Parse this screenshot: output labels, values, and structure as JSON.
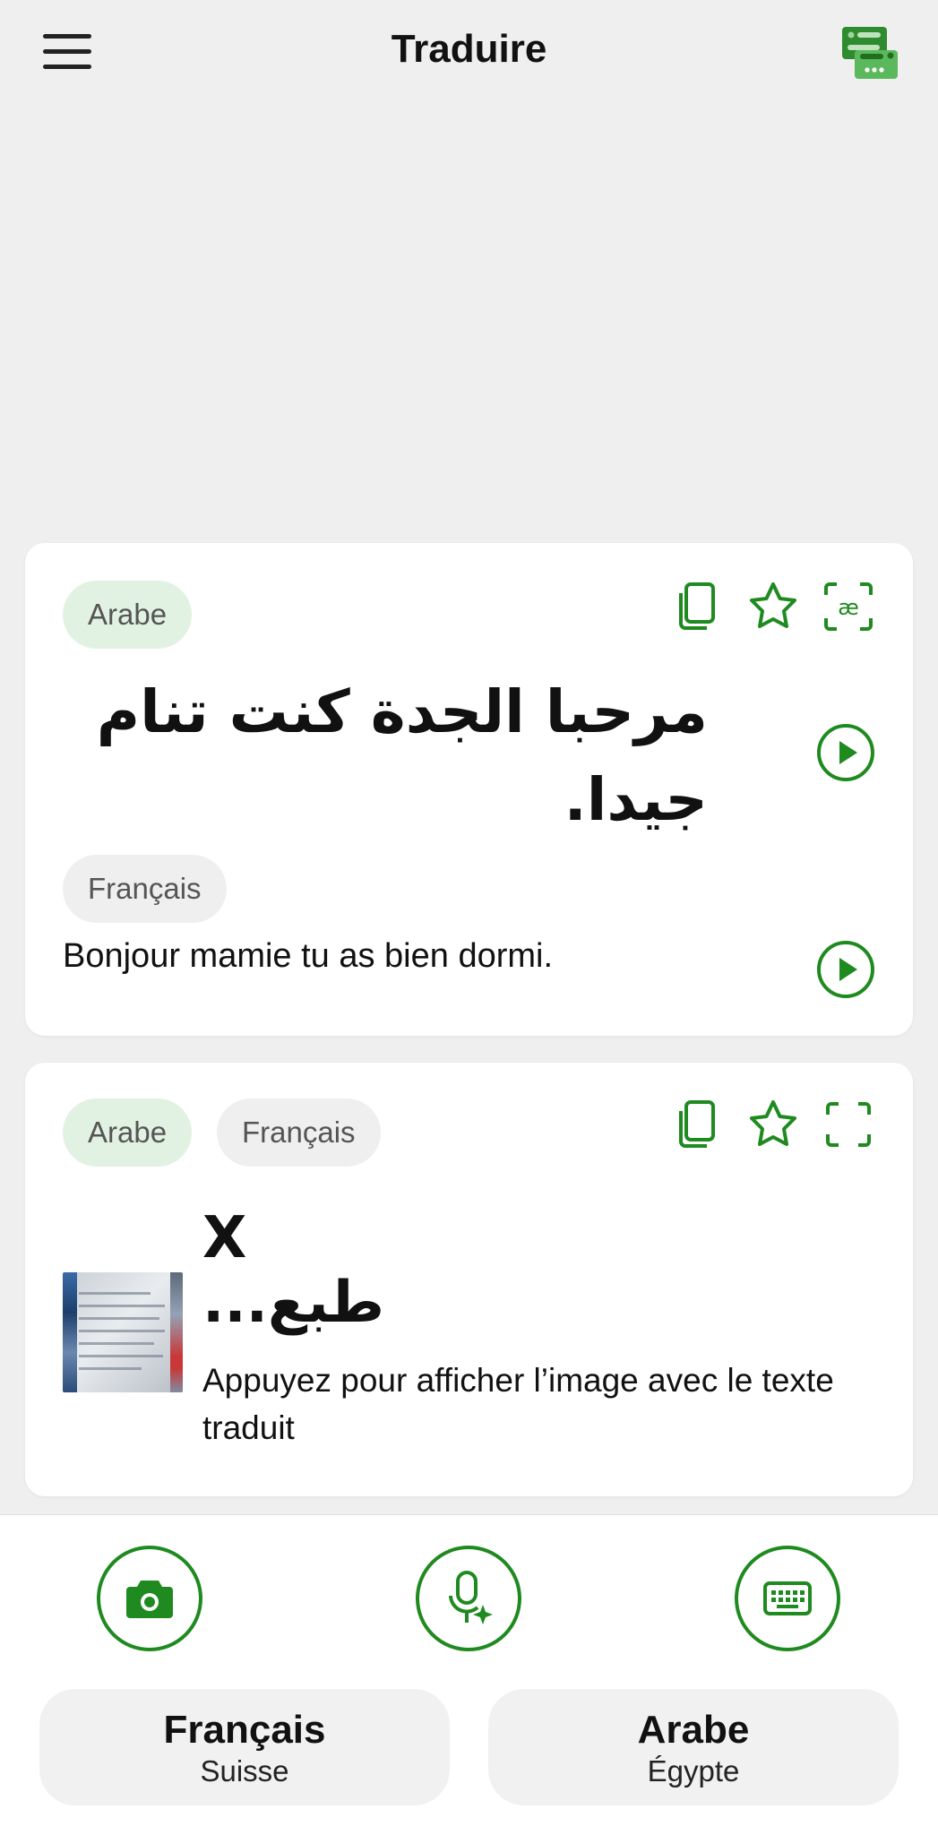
{
  "header": {
    "title": "Traduire",
    "menu_icon": "hamburger-menu-icon",
    "conversation_icon": "conversation-icon"
  },
  "colors": {
    "accent": "#1f8a1f",
    "pill_green": "#e2f2e2",
    "pill_gray": "#efefef",
    "background": "#efefef"
  },
  "cards": [
    {
      "source_lang": "Arabe",
      "source_text": "مرحبا الجدة كنت تنام جيدا.",
      "target_lang": "Français",
      "target_text": "Bonjour mamie tu as bien dormi.",
      "icons": [
        "copy-icon",
        "star-icon",
        "phonetic-icon",
        "play-icon"
      ]
    },
    {
      "source_lang": "Arabe",
      "target_lang": "Français",
      "image_title_line1": "X",
      "image_title_line2": "طبع...",
      "image_caption": "Appuyez pour afficher l’image avec le texte traduit",
      "icons": [
        "copy-icon",
        "star-icon",
        "fullscreen-icon"
      ]
    }
  ],
  "input_modes": [
    "camera-icon",
    "voice-ai-icon",
    "keyboard-icon"
  ],
  "languages": {
    "left": {
      "name": "Français",
      "region": "Suisse"
    },
    "right": {
      "name": "Arabe",
      "region": "Égypte"
    }
  }
}
